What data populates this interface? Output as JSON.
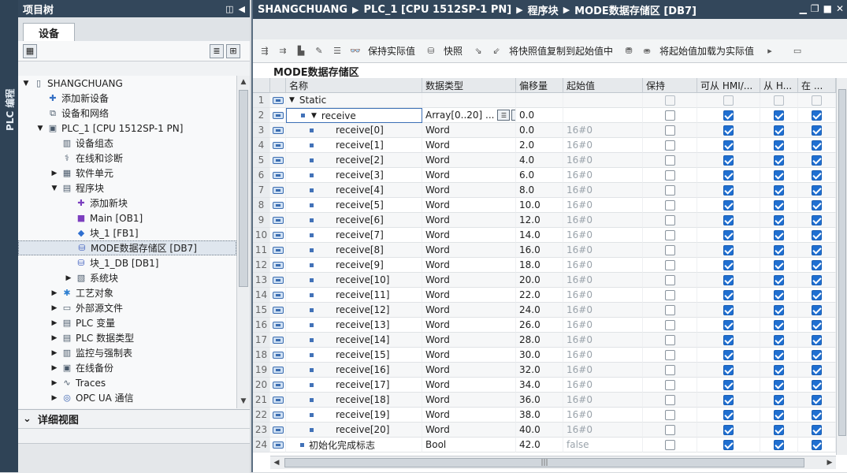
{
  "sidetab": {
    "label": "PLC 编程"
  },
  "project_tree": {
    "title": "项目树",
    "tab_label": "设备",
    "items": [
      {
        "label": "SHANGCHUANG",
        "icon": "project-icon",
        "indent": 0,
        "toggle": "▼"
      },
      {
        "label": "添加新设备",
        "icon": "add-device-icon",
        "indent": 1,
        "toggle": ""
      },
      {
        "label": "设备和网络",
        "icon": "network-icon",
        "indent": 1,
        "toggle": ""
      },
      {
        "label": "PLC_1 [CPU 1512SP-1 PN]",
        "icon": "plc-icon",
        "indent": 1,
        "toggle": "▼"
      },
      {
        "label": "设备组态",
        "icon": "device-config-icon",
        "indent": 2,
        "toggle": ""
      },
      {
        "label": "在线和诊断",
        "icon": "online-diag-icon",
        "indent": 2,
        "toggle": ""
      },
      {
        "label": "软件单元",
        "icon": "software-unit-icon",
        "indent": 2,
        "toggle": "▶"
      },
      {
        "label": "程序块",
        "icon": "program-blocks-icon",
        "indent": 2,
        "toggle": "▼"
      },
      {
        "label": "添加新块",
        "icon": "add-block-icon",
        "indent": 3,
        "toggle": ""
      },
      {
        "label": "Main [OB1]",
        "icon": "ob-icon",
        "indent": 3,
        "toggle": ""
      },
      {
        "label": "块_1 [FB1]",
        "icon": "fb-icon",
        "indent": 3,
        "toggle": ""
      },
      {
        "label": "MODE数据存储区 [DB7]",
        "icon": "db-icon",
        "indent": 3,
        "toggle": "",
        "selected": true
      },
      {
        "label": "块_1_DB [DB1]",
        "icon": "db-icon",
        "indent": 3,
        "toggle": ""
      },
      {
        "label": "系统块",
        "icon": "system-block-icon",
        "indent": 3,
        "toggle": "▶"
      },
      {
        "label": "工艺对象",
        "icon": "tech-object-icon",
        "indent": 2,
        "toggle": "▶"
      },
      {
        "label": "外部源文件",
        "icon": "external-source-icon",
        "indent": 2,
        "toggle": "▶"
      },
      {
        "label": "PLC 变量",
        "icon": "plc-tags-icon",
        "indent": 2,
        "toggle": "▶"
      },
      {
        "label": "PLC 数据类型",
        "icon": "plc-datatype-icon",
        "indent": 2,
        "toggle": "▶"
      },
      {
        "label": "监控与强制表",
        "icon": "watch-table-icon",
        "indent": 2,
        "toggle": "▶"
      },
      {
        "label": "在线备份",
        "icon": "online-backup-icon",
        "indent": 2,
        "toggle": "▶"
      },
      {
        "label": "Traces",
        "icon": "traces-icon",
        "indent": 2,
        "toggle": "▶"
      },
      {
        "label": "OPC UA 通信",
        "icon": "opcua-icon",
        "indent": 2,
        "toggle": "▶"
      }
    ]
  },
  "detail_view": {
    "title": "详细视图"
  },
  "editor": {
    "breadcrumb": [
      "SHANGCHUANG",
      "PLC_1 [CPU 1512SP-1 PN]",
      "程序块",
      "MODE数据存储区 [DB7]"
    ],
    "toolbar": {
      "keep_actual": "保持实际值",
      "snapshot": "快照",
      "copy_snapshot": "将快照值复制到起始值中",
      "load_start": "将起始值加载为实际值"
    },
    "block_title": "MODE数据存储区",
    "columns": {
      "name": "名称",
      "type": "数据类型",
      "offset": "偏移量",
      "start": "起始值",
      "retain": "保持",
      "hmi1": "可从 HMI/...",
      "hmi2": "从 H...",
      "hmi3": "在 ..."
    },
    "rows": [
      {
        "n": "1",
        "name": "Static",
        "level": 0,
        "caret": "▼",
        "bullet": false,
        "type": "",
        "offset": "",
        "start": "",
        "retain": "empty",
        "hmi1": "empty",
        "hmi2": "empty",
        "hmi3": "empty"
      },
      {
        "n": "2",
        "name": "receive",
        "level": 1,
        "caret": "▼",
        "bullet": true,
        "type": "Array[0..20] ...",
        "offset": "0.0",
        "start": "",
        "retain": "off",
        "hmi1": "on",
        "hmi2": "on",
        "hmi3": "on",
        "selected": true
      },
      {
        "n": "3",
        "name": "receive[0]",
        "level": 2,
        "caret": "",
        "bullet": true,
        "type": "Word",
        "offset": "0.0",
        "start": "16#0",
        "retain": "off",
        "hmi1": "on",
        "hmi2": "on",
        "hmi3": "on"
      },
      {
        "n": "4",
        "name": "receive[1]",
        "level": 2,
        "caret": "",
        "bullet": true,
        "type": "Word",
        "offset": "2.0",
        "start": "16#0",
        "retain": "off",
        "hmi1": "on",
        "hmi2": "on",
        "hmi3": "on"
      },
      {
        "n": "5",
        "name": "receive[2]",
        "level": 2,
        "caret": "",
        "bullet": true,
        "type": "Word",
        "offset": "4.0",
        "start": "16#0",
        "retain": "off",
        "hmi1": "on",
        "hmi2": "on",
        "hmi3": "on"
      },
      {
        "n": "6",
        "name": "receive[3]",
        "level": 2,
        "caret": "",
        "bullet": true,
        "type": "Word",
        "offset": "6.0",
        "start": "16#0",
        "retain": "off",
        "hmi1": "on",
        "hmi2": "on",
        "hmi3": "on"
      },
      {
        "n": "7",
        "name": "receive[4]",
        "level": 2,
        "caret": "",
        "bullet": true,
        "type": "Word",
        "offset": "8.0",
        "start": "16#0",
        "retain": "off",
        "hmi1": "on",
        "hmi2": "on",
        "hmi3": "on"
      },
      {
        "n": "8",
        "name": "receive[5]",
        "level": 2,
        "caret": "",
        "bullet": true,
        "type": "Word",
        "offset": "10.0",
        "start": "16#0",
        "retain": "off",
        "hmi1": "on",
        "hmi2": "on",
        "hmi3": "on"
      },
      {
        "n": "9",
        "name": "receive[6]",
        "level": 2,
        "caret": "",
        "bullet": true,
        "type": "Word",
        "offset": "12.0",
        "start": "16#0",
        "retain": "off",
        "hmi1": "on",
        "hmi2": "on",
        "hmi3": "on"
      },
      {
        "n": "10",
        "name": "receive[7]",
        "level": 2,
        "caret": "",
        "bullet": true,
        "type": "Word",
        "offset": "14.0",
        "start": "16#0",
        "retain": "off",
        "hmi1": "on",
        "hmi2": "on",
        "hmi3": "on"
      },
      {
        "n": "11",
        "name": "receive[8]",
        "level": 2,
        "caret": "",
        "bullet": true,
        "type": "Word",
        "offset": "16.0",
        "start": "16#0",
        "retain": "off",
        "hmi1": "on",
        "hmi2": "on",
        "hmi3": "on"
      },
      {
        "n": "12",
        "name": "receive[9]",
        "level": 2,
        "caret": "",
        "bullet": true,
        "type": "Word",
        "offset": "18.0",
        "start": "16#0",
        "retain": "off",
        "hmi1": "on",
        "hmi2": "on",
        "hmi3": "on"
      },
      {
        "n": "13",
        "name": "receive[10]",
        "level": 2,
        "caret": "",
        "bullet": true,
        "type": "Word",
        "offset": "20.0",
        "start": "16#0",
        "retain": "off",
        "hmi1": "on",
        "hmi2": "on",
        "hmi3": "on"
      },
      {
        "n": "14",
        "name": "receive[11]",
        "level": 2,
        "caret": "",
        "bullet": true,
        "type": "Word",
        "offset": "22.0",
        "start": "16#0",
        "retain": "off",
        "hmi1": "on",
        "hmi2": "on",
        "hmi3": "on"
      },
      {
        "n": "15",
        "name": "receive[12]",
        "level": 2,
        "caret": "",
        "bullet": true,
        "type": "Word",
        "offset": "24.0",
        "start": "16#0",
        "retain": "off",
        "hmi1": "on",
        "hmi2": "on",
        "hmi3": "on"
      },
      {
        "n": "16",
        "name": "receive[13]",
        "level": 2,
        "caret": "",
        "bullet": true,
        "type": "Word",
        "offset": "26.0",
        "start": "16#0",
        "retain": "off",
        "hmi1": "on",
        "hmi2": "on",
        "hmi3": "on"
      },
      {
        "n": "17",
        "name": "receive[14]",
        "level": 2,
        "caret": "",
        "bullet": true,
        "type": "Word",
        "offset": "28.0",
        "start": "16#0",
        "retain": "off",
        "hmi1": "on",
        "hmi2": "on",
        "hmi3": "on"
      },
      {
        "n": "18",
        "name": "receive[15]",
        "level": 2,
        "caret": "",
        "bullet": true,
        "type": "Word",
        "offset": "30.0",
        "start": "16#0",
        "retain": "off",
        "hmi1": "on",
        "hmi2": "on",
        "hmi3": "on"
      },
      {
        "n": "19",
        "name": "receive[16]",
        "level": 2,
        "caret": "",
        "bullet": true,
        "type": "Word",
        "offset": "32.0",
        "start": "16#0",
        "retain": "off",
        "hmi1": "on",
        "hmi2": "on",
        "hmi3": "on"
      },
      {
        "n": "20",
        "name": "receive[17]",
        "level": 2,
        "caret": "",
        "bullet": true,
        "type": "Word",
        "offset": "34.0",
        "start": "16#0",
        "retain": "off",
        "hmi1": "on",
        "hmi2": "on",
        "hmi3": "on"
      },
      {
        "n": "21",
        "name": "receive[18]",
        "level": 2,
        "caret": "",
        "bullet": true,
        "type": "Word",
        "offset": "36.0",
        "start": "16#0",
        "retain": "off",
        "hmi1": "on",
        "hmi2": "on",
        "hmi3": "on"
      },
      {
        "n": "22",
        "name": "receive[19]",
        "level": 2,
        "caret": "",
        "bullet": true,
        "type": "Word",
        "offset": "38.0",
        "start": "16#0",
        "retain": "off",
        "hmi1": "on",
        "hmi2": "on",
        "hmi3": "on"
      },
      {
        "n": "23",
        "name": "receive[20]",
        "level": 2,
        "caret": "",
        "bullet": true,
        "type": "Word",
        "offset": "40.0",
        "start": "16#0",
        "retain": "off",
        "hmi1": "on",
        "hmi2": "on",
        "hmi3": "on"
      },
      {
        "n": "24",
        "name": "初始化完成标志",
        "level": 1,
        "caret": "",
        "bullet": true,
        "type": "Bool",
        "offset": "42.0",
        "start": "false",
        "retain": "off",
        "hmi1": "on",
        "hmi2": "on",
        "hmi3": "on"
      }
    ]
  },
  "colors": {
    "header_bg": "#33475b",
    "checkbox_on": "#1f6fd1",
    "selection": "#dfe6ee"
  }
}
